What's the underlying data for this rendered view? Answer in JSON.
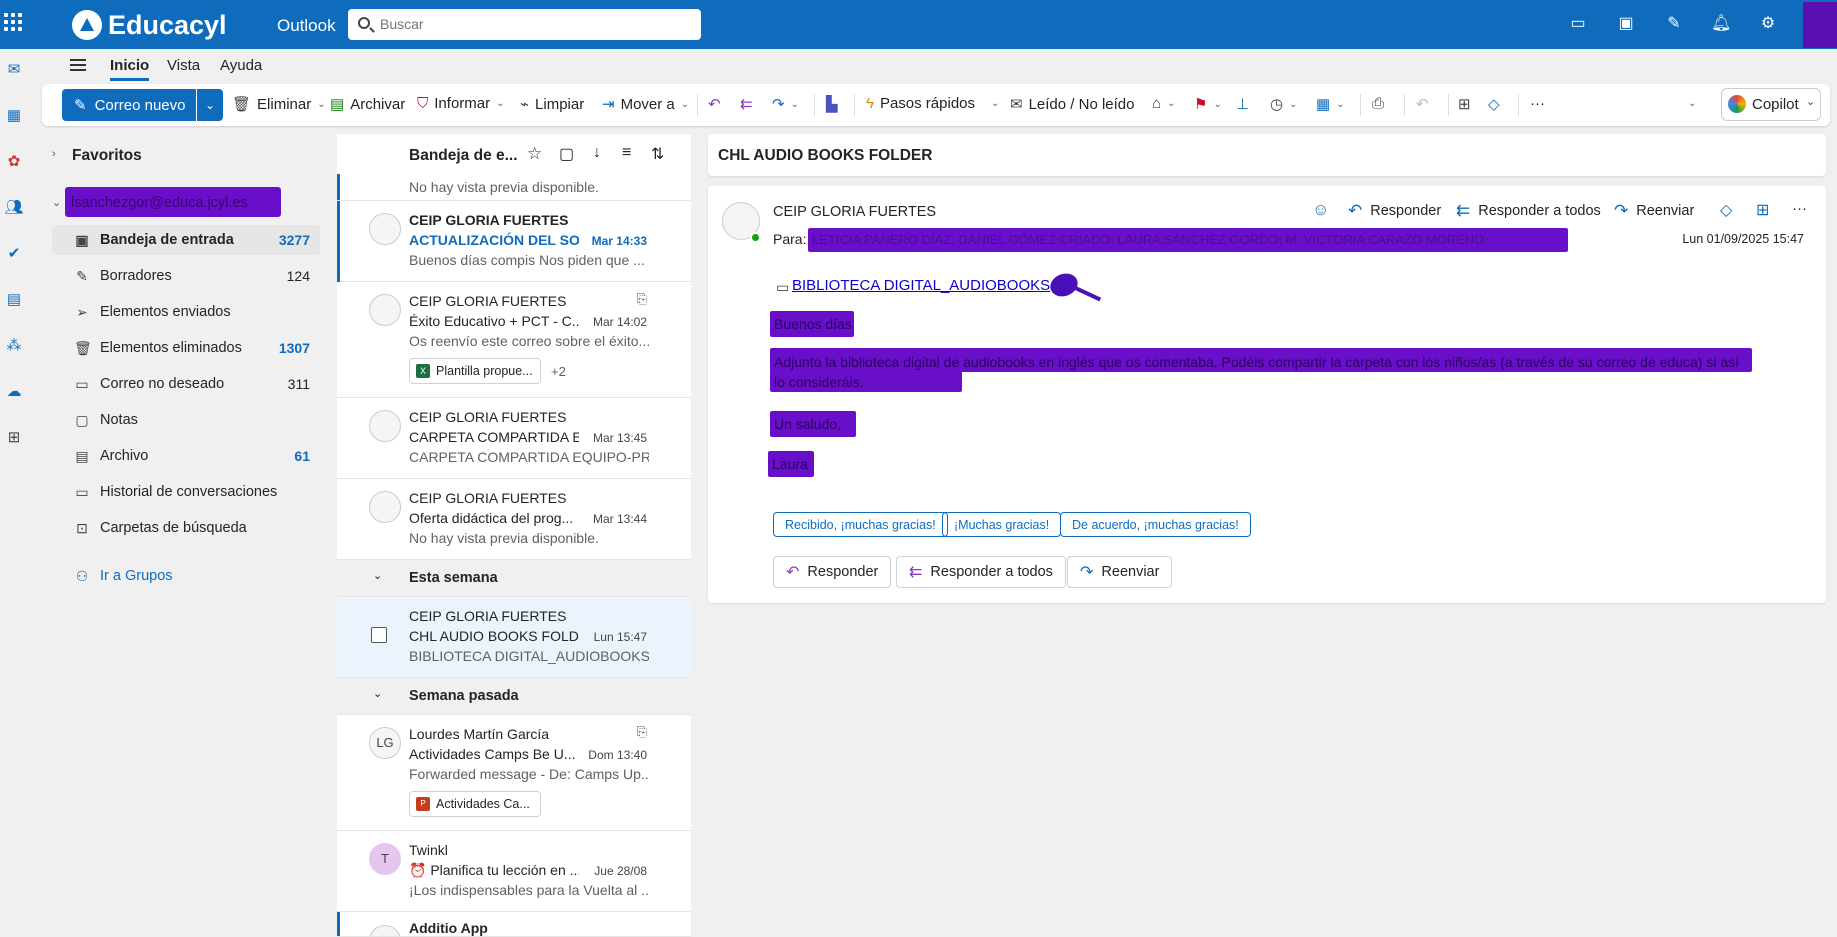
{
  "topbar": {
    "brand": "Educacyl",
    "app": "Outlook",
    "search_placeholder": "Buscar"
  },
  "menu": {
    "tabs": [
      "Inicio",
      "Vista",
      "Ayuda"
    ]
  },
  "ribbon": {
    "new_mail": "Correo nuevo",
    "delete": "Eliminar",
    "archive": "Archivar",
    "report": "Informar",
    "sweep": "Limpiar",
    "move": "Mover a",
    "quick_steps": "Pasos rápidos",
    "read_unread": "Leído / No leído",
    "copilot": "Copilot"
  },
  "folders": {
    "favorites": "Favoritos",
    "account": "lsanchezgor@educa.jcyl.es",
    "items": [
      {
        "label": "Bandeja de entrada",
        "count": "3277"
      },
      {
        "label": "Borradores",
        "count": "124"
      },
      {
        "label": "Elementos enviados",
        "count": ""
      },
      {
        "label": "Elementos eliminados",
        "count": "1307"
      },
      {
        "label": "Correo no deseado",
        "count": "311"
      },
      {
        "label": "Notas",
        "count": ""
      },
      {
        "label": "Archivo",
        "count": "61"
      },
      {
        "label": "Historial de conversaciones",
        "count": ""
      },
      {
        "label": "Carpetas de búsqueda",
        "count": ""
      }
    ],
    "groups": "Ir a Grupos"
  },
  "maillist": {
    "title": "Bandeja de e...",
    "top_preview": "No hay vista previa disponible.",
    "messages": [
      {
        "sender": "CEIP GLORIA FUERTES",
        "subject": "ACTUALIZACIÓN DEL SO...",
        "time": "Mar 14:33",
        "preview": "Buenos días compis Nos piden que ..."
      },
      {
        "sender": "CEIP GLORIA FUERTES",
        "subject": "Éxito Educativo + PCT - C...",
        "time": "Mar 14:02",
        "preview": "Os reenvío este correo sobre el éxito...",
        "attachment": "Plantilla propue...",
        "more": "+2"
      },
      {
        "sender": "CEIP GLORIA FUERTES",
        "subject": "CARPETA COMPARTIDA E...",
        "time": "Mar 13:45",
        "preview": "CARPETA COMPARTIDA EQUIPO-PR..."
      },
      {
        "sender": "CEIP GLORIA FUERTES",
        "subject": "Oferta didáctica del prog...",
        "time": "Mar 13:44",
        "preview": "No hay vista previa disponible."
      },
      {
        "sender": "CEIP GLORIA FUERTES",
        "subject": "CHL AUDIO BOOKS FOLD...",
        "time": "Lun 15:47",
        "preview": "BIBLIOTECA DIGITAL_AUDIOBOOKS ..."
      },
      {
        "sender": "Lourdes Martín García",
        "initials": "LG",
        "subject": "Actividades Camps Be U...",
        "time": "Dom 13:40",
        "preview": "Forwarded message - De: Camps Up...",
        "attachment": "Actividades Ca..."
      },
      {
        "sender": "Twinkl",
        "initials": "T",
        "subject": "⏰ Planifica tu lección en ...",
        "time": "Jue 28/08",
        "preview": "¡Los indispensables para la Vuelta al ..."
      },
      {
        "sender": "Additio App"
      }
    ],
    "sections": [
      "Esta semana",
      "Semana pasada"
    ]
  },
  "reading": {
    "subject": "CHL AUDIO BOOKS FOLDER",
    "from": "CEIP GLORIA FUERTES",
    "to_label": "Para:",
    "recipients": "LETICIA PANERO DÍAZ; DANIEL GÓMEZ CRIADO; LAURA SÁNCHEZ GORDO; M. VICTORIA CARAZO MORENO",
    "date": "Lun 01/09/2025 15:47",
    "actions": {
      "reply": "Responder",
      "reply_all": "Responder a todos",
      "forward": "Reenviar"
    },
    "link": "BIBLIOTECA DIGITAL_AUDIOBOOKS",
    "body": {
      "greeting": "Buenos días",
      "para": "Adjunto la biblioteca digital de audiobooks en inglés que os comentaba. Podéis compartir la carpeta con los niños/as (a través de su correo de educa) si así lo consideráis.",
      "closing": "Un saludo,",
      "signature": "Laura"
    },
    "quick_replies": [
      "Recibido, ¡muchas gracias!",
      "¡Muchas gracias!",
      "De acuerdo, ¡muchas gracias!"
    ]
  }
}
